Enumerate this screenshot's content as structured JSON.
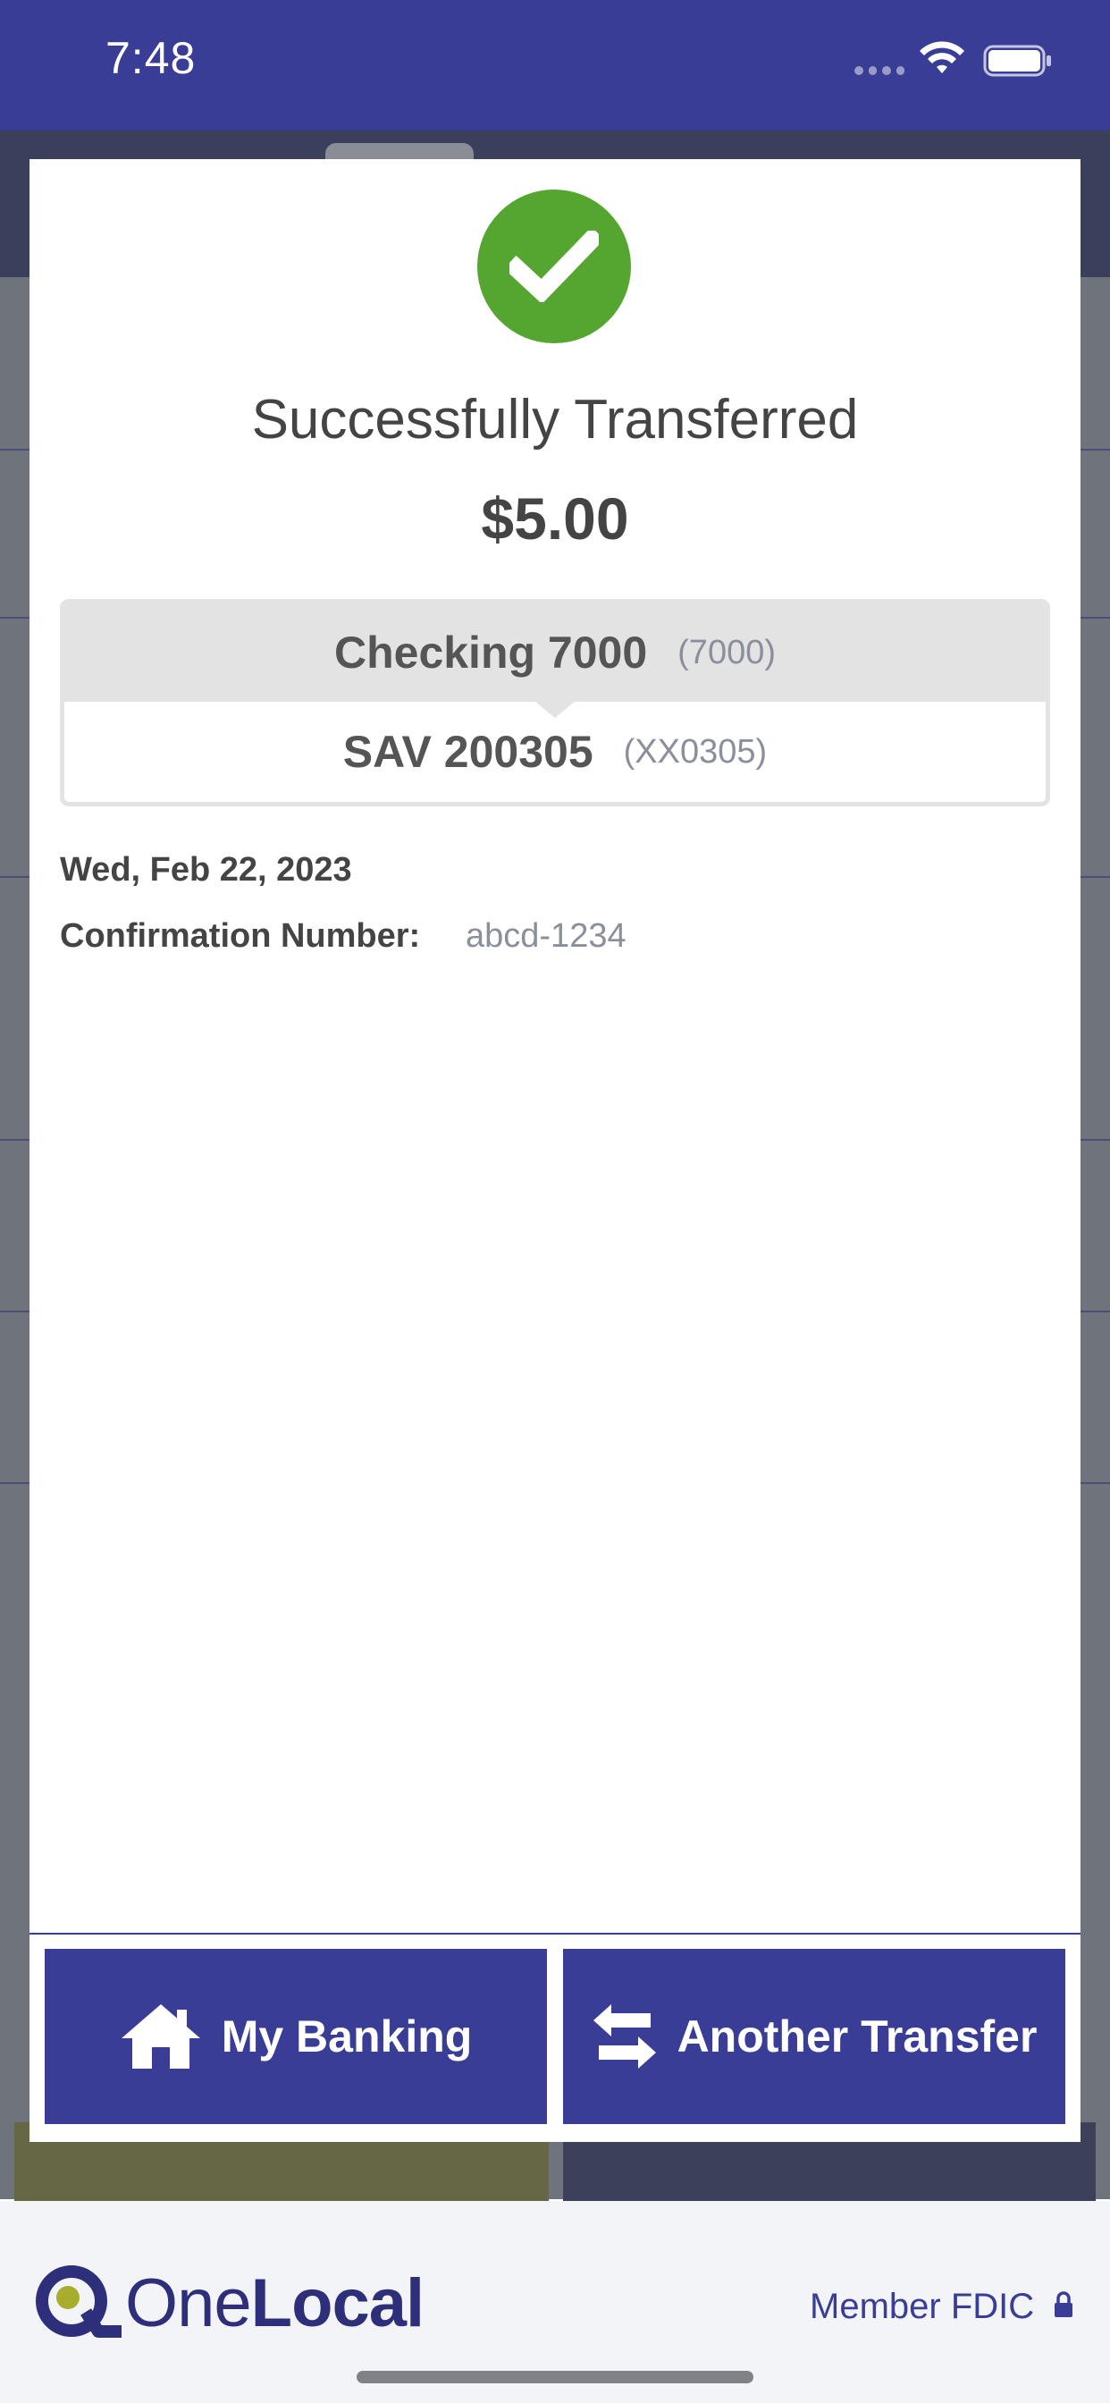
{
  "status_bar": {
    "time": "7:48"
  },
  "modal": {
    "title": "Successfully Transferred",
    "amount": "$5.00",
    "from_account": {
      "name": "Checking 7000",
      "number": "(7000)"
    },
    "to_account": {
      "name": "SAV 200305",
      "number": "(XX0305)"
    },
    "date": "Wed, Feb 22, 2023",
    "confirmation_label": "Confirmation Number:",
    "confirmation_value": "abcd-1234",
    "actions": {
      "my_banking": "My Banking",
      "another_transfer": "Another Transfer"
    }
  },
  "footer": {
    "logo_one": "One",
    "logo_local": "Local",
    "member_fdic": "Member FDIC"
  },
  "colors": {
    "brand": "#3a3d96",
    "success": "#55a630",
    "logo_accent": "#a8ad2e"
  },
  "icons": {
    "success": "checkmark-icon",
    "my_banking": "home-icon",
    "another_transfer": "swap-arrows-icon",
    "fdic": "lock-icon"
  }
}
